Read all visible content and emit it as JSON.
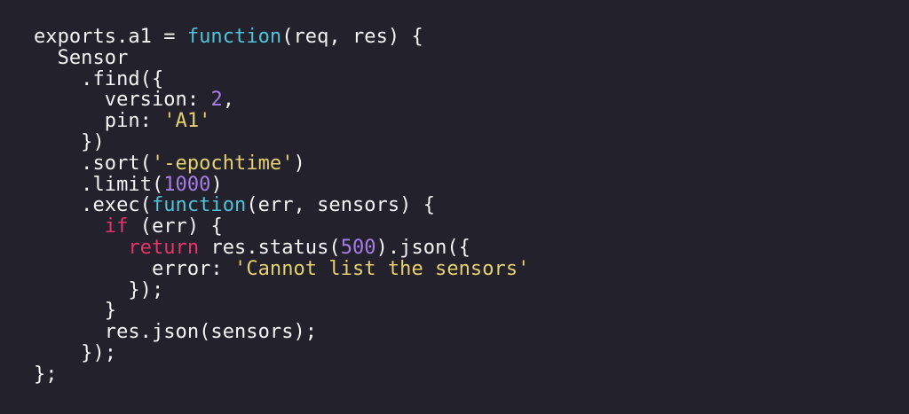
{
  "colors": {
    "background": "#22212c",
    "plain": "#f4f4f4",
    "function": "#4fc3d9",
    "number": "#a77ee8",
    "string": "#e3d26f",
    "keyword": "#e8336b"
  },
  "code": {
    "lines": [
      [
        {
          "t": "exports.a1 = ",
          "k": "plain"
        },
        {
          "t": "function",
          "k": "function"
        },
        {
          "t": "(req, res) {",
          "k": "plain"
        }
      ],
      [
        {
          "t": "  Sensor",
          "k": "plain"
        }
      ],
      [
        {
          "t": "    .find({",
          "k": "plain"
        }
      ],
      [
        {
          "t": "      version: ",
          "k": "plain"
        },
        {
          "t": "2",
          "k": "number"
        },
        {
          "t": ",",
          "k": "plain"
        }
      ],
      [
        {
          "t": "      pin: ",
          "k": "plain"
        },
        {
          "t": "'A1'",
          "k": "string"
        }
      ],
      [
        {
          "t": "    })",
          "k": "plain"
        }
      ],
      [
        {
          "t": "    .sort(",
          "k": "plain"
        },
        {
          "t": "'-epochtime'",
          "k": "string"
        },
        {
          "t": ")",
          "k": "plain"
        }
      ],
      [
        {
          "t": "    .limit(",
          "k": "plain"
        },
        {
          "t": "1000",
          "k": "number"
        },
        {
          "t": ")",
          "k": "plain"
        }
      ],
      [
        {
          "t": "    .exec(",
          "k": "plain"
        },
        {
          "t": "function",
          "k": "function"
        },
        {
          "t": "(err, sensors) {",
          "k": "plain"
        }
      ],
      [
        {
          "t": "      ",
          "k": "plain"
        },
        {
          "t": "if",
          "k": "keyword"
        },
        {
          "t": " (err) {",
          "k": "plain"
        }
      ],
      [
        {
          "t": "        ",
          "k": "plain"
        },
        {
          "t": "return",
          "k": "keyword"
        },
        {
          "t": " res.status(",
          "k": "plain"
        },
        {
          "t": "500",
          "k": "number"
        },
        {
          "t": ").json({",
          "k": "plain"
        }
      ],
      [
        {
          "t": "          error: ",
          "k": "plain"
        },
        {
          "t": "'Cannot list the sensors'",
          "k": "string"
        }
      ],
      [
        {
          "t": "        });",
          "k": "plain"
        }
      ],
      [
        {
          "t": "      }",
          "k": "plain"
        }
      ],
      [
        {
          "t": "      res.json(sensors);",
          "k": "plain"
        }
      ],
      [
        {
          "t": "    });",
          "k": "plain"
        }
      ],
      [
        {
          "t": "};",
          "k": "plain"
        }
      ]
    ]
  }
}
